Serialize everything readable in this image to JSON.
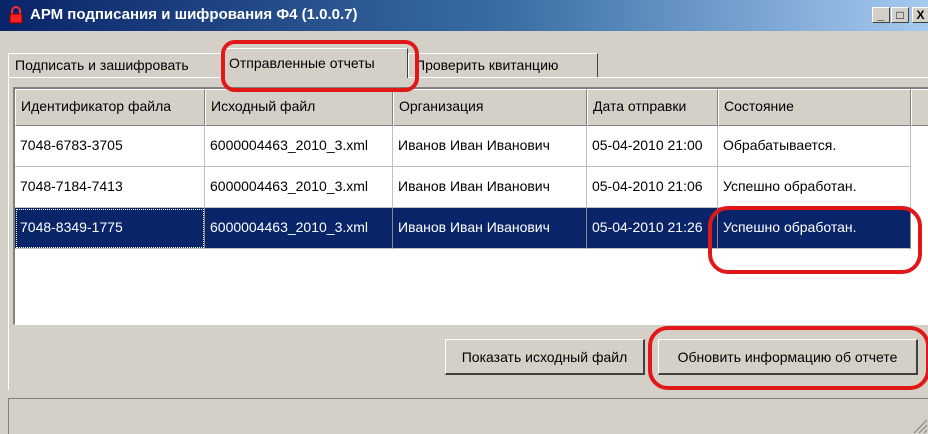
{
  "window": {
    "title": "АРМ  подписания и шифрования Ф4 (1.0.0.7)",
    "controls": {
      "minimize": "_",
      "maximize": "□",
      "close": "X"
    }
  },
  "tabs": [
    {
      "label": "Подписать и зашифровать",
      "active": false
    },
    {
      "label": "Отправленные отчеты",
      "active": true
    },
    {
      "label": "Проверить квитанцию",
      "active": false
    }
  ],
  "table": {
    "columns": [
      "Идентификатор файла",
      "Исходный файл",
      "Организация",
      "Дата отправки",
      "Состояние"
    ],
    "rows": [
      {
        "id": "7048-6783-3705",
        "file": "6000004463_2010_3.xml",
        "org": "Иванов Иван Иванович",
        "date": "05-04-2010 21:00",
        "state": "Обрабатывается.",
        "selected": false
      },
      {
        "id": "7048-7184-7413",
        "file": "6000004463_2010_3.xml",
        "org": "Иванов Иван Иванович",
        "date": "05-04-2010 21:06",
        "state": "Успешно обработан.",
        "selected": false
      },
      {
        "id": "7048-8349-1775",
        "file": "6000004463_2010_3.xml",
        "org": "Иванов Иван Иванович",
        "date": "05-04-2010 21:26",
        "state": "Успешно обработан.",
        "selected": true
      }
    ]
  },
  "buttons": {
    "show_source": "Показать исходный файл",
    "refresh_info": "Обновить информацию об отчете"
  },
  "colors": {
    "highlight": "#e01818",
    "selection": "#0a246a",
    "face": "#d4d0c8"
  }
}
